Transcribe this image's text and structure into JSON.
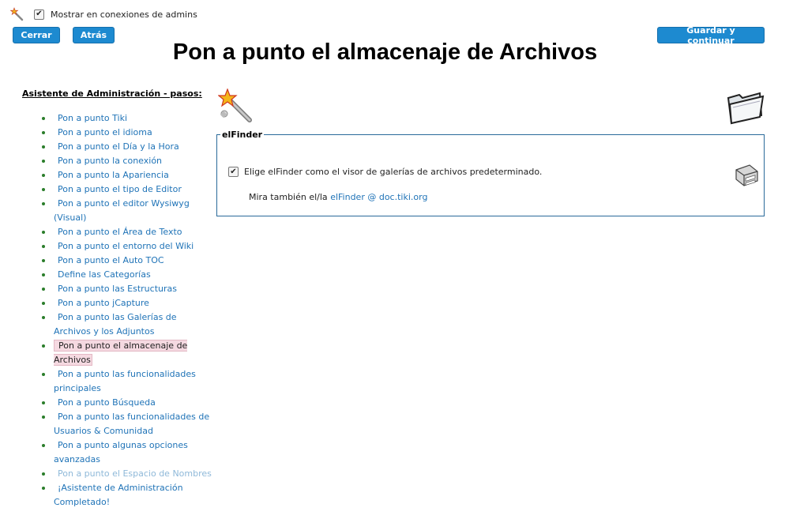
{
  "topbar": {
    "show_in_admin_label": "Mostrar en conexiones de admins",
    "show_in_admin_checked": true
  },
  "buttons": {
    "close": "Cerrar",
    "back": "Atrás",
    "save_continue": "Guardar y continuar"
  },
  "page_title": "Pon a punto el almacenaje de Archivos",
  "sidebar": {
    "heading": "Asistente de Administración - pasos:",
    "steps": [
      {
        "label": "Pon a punto Tiki",
        "state": "link"
      },
      {
        "label": "Pon a punto el idioma",
        "state": "link"
      },
      {
        "label": "Pon a punto el Día y la Hora",
        "state": "link"
      },
      {
        "label": "Pon a punto la conexión",
        "state": "link"
      },
      {
        "label": "Pon a punto la Apariencia",
        "state": "link"
      },
      {
        "label": "Pon a punto el tipo de Editor",
        "state": "link"
      },
      {
        "label": "Pon a punto el editor Wysiwyg (Visual)",
        "state": "link"
      },
      {
        "label": "Pon a punto el Área de Texto",
        "state": "link"
      },
      {
        "label": "Pon a punto el entorno del Wiki",
        "state": "link"
      },
      {
        "label": "Pon a punto el Auto TOC",
        "state": "link"
      },
      {
        "label": "Define las Categorías",
        "state": "link"
      },
      {
        "label": "Pon a punto las Estructuras",
        "state": "link"
      },
      {
        "label": "Pon a punto jCapture",
        "state": "link"
      },
      {
        "label": "Pon a punto las Galerías de Archivos y los Adjuntos",
        "state": "link"
      },
      {
        "label": "Pon a punto el almacenaje de Archivos",
        "state": "current"
      },
      {
        "label": "Pon a punto las funcionalidades principales",
        "state": "link"
      },
      {
        "label": "Pon a punto Búsqueda",
        "state": "link"
      },
      {
        "label": "Pon a punto las funcionalidades de Usuarios & Comunidad",
        "state": "link"
      },
      {
        "label": "Pon a punto algunas opciones avanzadas",
        "state": "link"
      },
      {
        "label": "Pon a punto el Espacio de Nombres",
        "state": "disabled"
      },
      {
        "label": "¡Asistente de Administración Completado!",
        "state": "link"
      }
    ]
  },
  "main": {
    "fieldset_legend": "elFinder",
    "pref_label": "Elige elFinder como el visor de galerías de archivos predeterminado.",
    "pref_checked": true,
    "see_also_prefix": "Mira también el/la",
    "see_also_link": "elFinder @ doc.tiki.org",
    "icons": [
      "wizard-wand-icon",
      "folder-icon",
      "file-cabinet-icon"
    ]
  },
  "colors": {
    "button_bg": "#1d8ad0",
    "link": "#1f73b7",
    "current_step_bg": "#f5d9e1",
    "fieldset_border": "#2a6a9a"
  }
}
